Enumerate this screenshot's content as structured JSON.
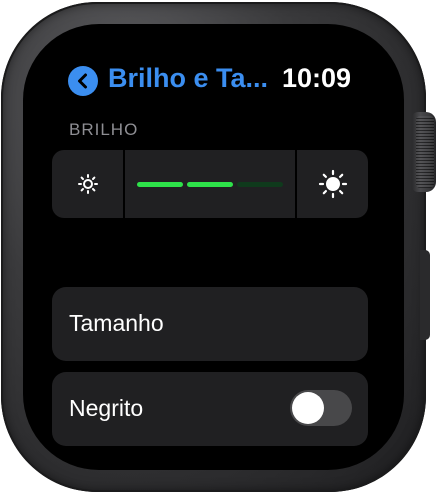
{
  "header": {
    "back_title": "Brilho e Ta...",
    "time": "10:09"
  },
  "brightness": {
    "section_label": "BRILHO",
    "level_segments": 3,
    "segments_on": 2,
    "active_color": "#2ee24a"
  },
  "rows": {
    "size_label": "Tamanho",
    "bold_label": "Negrito",
    "bold_enabled": false
  },
  "colors": {
    "accent": "#3b8ef0",
    "cell_background": "#202022",
    "section_label": "#8e8e93"
  },
  "icons": {
    "back": "chevron-left-icon",
    "brightness_low": "sun-small-icon",
    "brightness_high": "sun-large-icon"
  }
}
